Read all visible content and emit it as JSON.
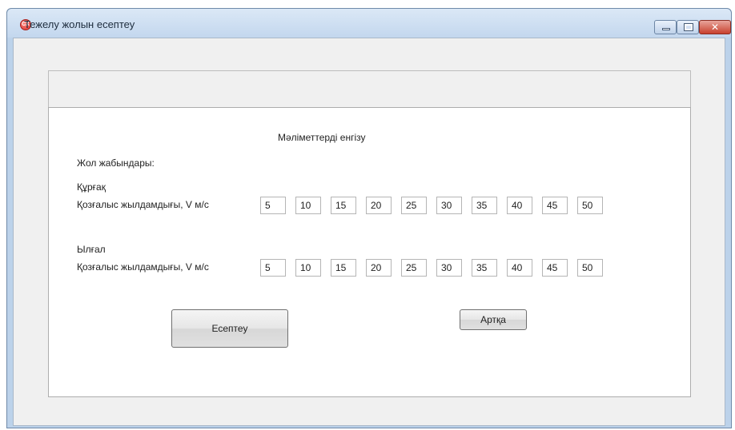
{
  "window": {
    "title": "Тежелу жолын есептеу",
    "app_icon_text": "CX",
    "close_glyph": "✕"
  },
  "form": {
    "heading": "Мәліметтерді енгізу",
    "road_surface_label": "Жол жабындары:",
    "dry": {
      "label": "Құрғақ",
      "speed_label": "Қозғалыс жылдамдығы, V м/с",
      "values": [
        "5",
        "10",
        "15",
        "20",
        "25",
        "30",
        "35",
        "40",
        "45",
        "50"
      ]
    },
    "wet": {
      "label": "Ылғал",
      "speed_label": "Қозғалыс жылдамдығы, V м/с",
      "values": [
        "5",
        "10",
        "15",
        "20",
        "25",
        "30",
        "35",
        "40",
        "45",
        "50"
      ]
    },
    "calculate_button": "Есептеу",
    "back_button": "Артқа"
  },
  "icons": {
    "app": "app-logo-icon",
    "minimize": "minimize-icon",
    "maximize": "maximize-icon",
    "close": "close-icon"
  },
  "colors": {
    "title_bar": "#c3d7ee",
    "close_button": "#c8412e",
    "client_background": "#f0f0f0"
  }
}
